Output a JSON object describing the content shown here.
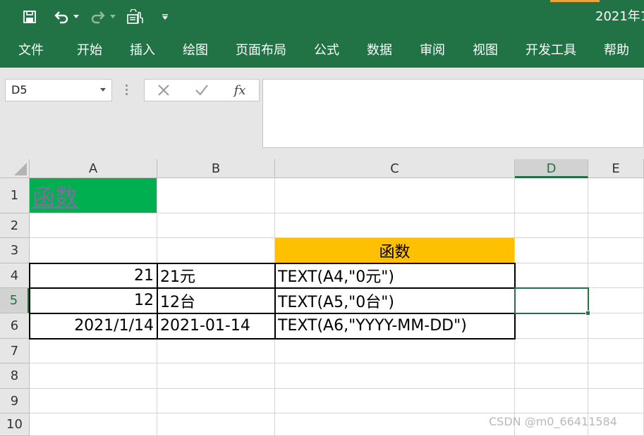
{
  "quick_access": {
    "save_icon": "save-icon",
    "undo_icon": "undo-icon",
    "redo_icon": "redo-icon",
    "touch_icon": "touch-mode-icon",
    "customize_icon": "customize-dropdown-icon"
  },
  "title": "2021年1",
  "ribbon_tabs": [
    "文件",
    "开始",
    "插入",
    "绘图",
    "页面布局",
    "公式",
    "数据",
    "审阅",
    "视图",
    "开发工具",
    "帮助"
  ],
  "formula_bar": {
    "name_box": "D5",
    "cancel_icon": "cancel-x-icon",
    "enter_icon": "enter-check-icon",
    "fx_label": "fx",
    "formula": ""
  },
  "columns": [
    "A",
    "B",
    "C",
    "D",
    "E"
  ],
  "rows": [
    "1",
    "2",
    "3",
    "4",
    "5",
    "6",
    "7",
    "8",
    "9",
    "10"
  ],
  "selected": {
    "column": "D",
    "row": "5"
  },
  "cells": {
    "A1": "函数",
    "C3": "函数",
    "A4": "21",
    "B4": "21元",
    "C4": "TEXT(A4,\"0元\")",
    "A5": "12",
    "B5": "12台",
    "C5": "TEXT(A5,\"0台\")",
    "A6": "2021/1/14",
    "B6": "2021-01-14",
    "C6": "TEXT(A6,\"YYYY-MM-DD\")"
  },
  "colors": {
    "ribbon": "#217346",
    "a1_fill": "#00b050",
    "c3_fill": "#ffc000",
    "selection": "#217346"
  },
  "watermark": "CSDN @m0_66411584"
}
